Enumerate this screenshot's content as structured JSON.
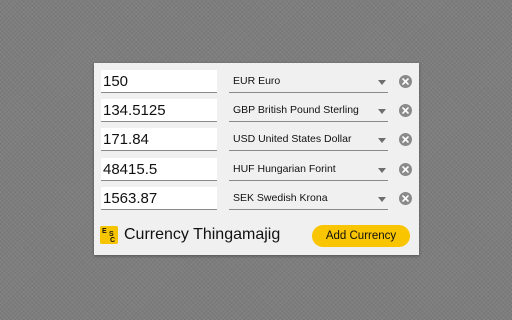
{
  "currencies": [
    {
      "amount": "150",
      "currency": "EUR Euro",
      "remove_icon": "close-circle-icon"
    },
    {
      "amount": "134.5125",
      "currency": "GBP British Pound Sterling",
      "remove_icon": "close-circle-icon"
    },
    {
      "amount": "171.84",
      "currency": "USD United States Dollar",
      "remove_icon": "close-circle-icon"
    },
    {
      "amount": "48415.5",
      "currency": "HUF Hungarian Forint",
      "remove_icon": "close-circle-icon"
    },
    {
      "amount": "1563.87",
      "currency": "SEK Swedish Krona",
      "remove_icon": "close-circle-icon"
    }
  ],
  "footer": {
    "logo_letters": [
      "E",
      "S",
      "C"
    ],
    "title": "Currency Thingamajig",
    "add_button_label": "Add Currency"
  },
  "colors": {
    "accent": "#f9c400",
    "panel_bg": "#f0f0f0",
    "page_bg": "#7d7d7d",
    "remove_icon_bg": "#8a8a8a"
  }
}
